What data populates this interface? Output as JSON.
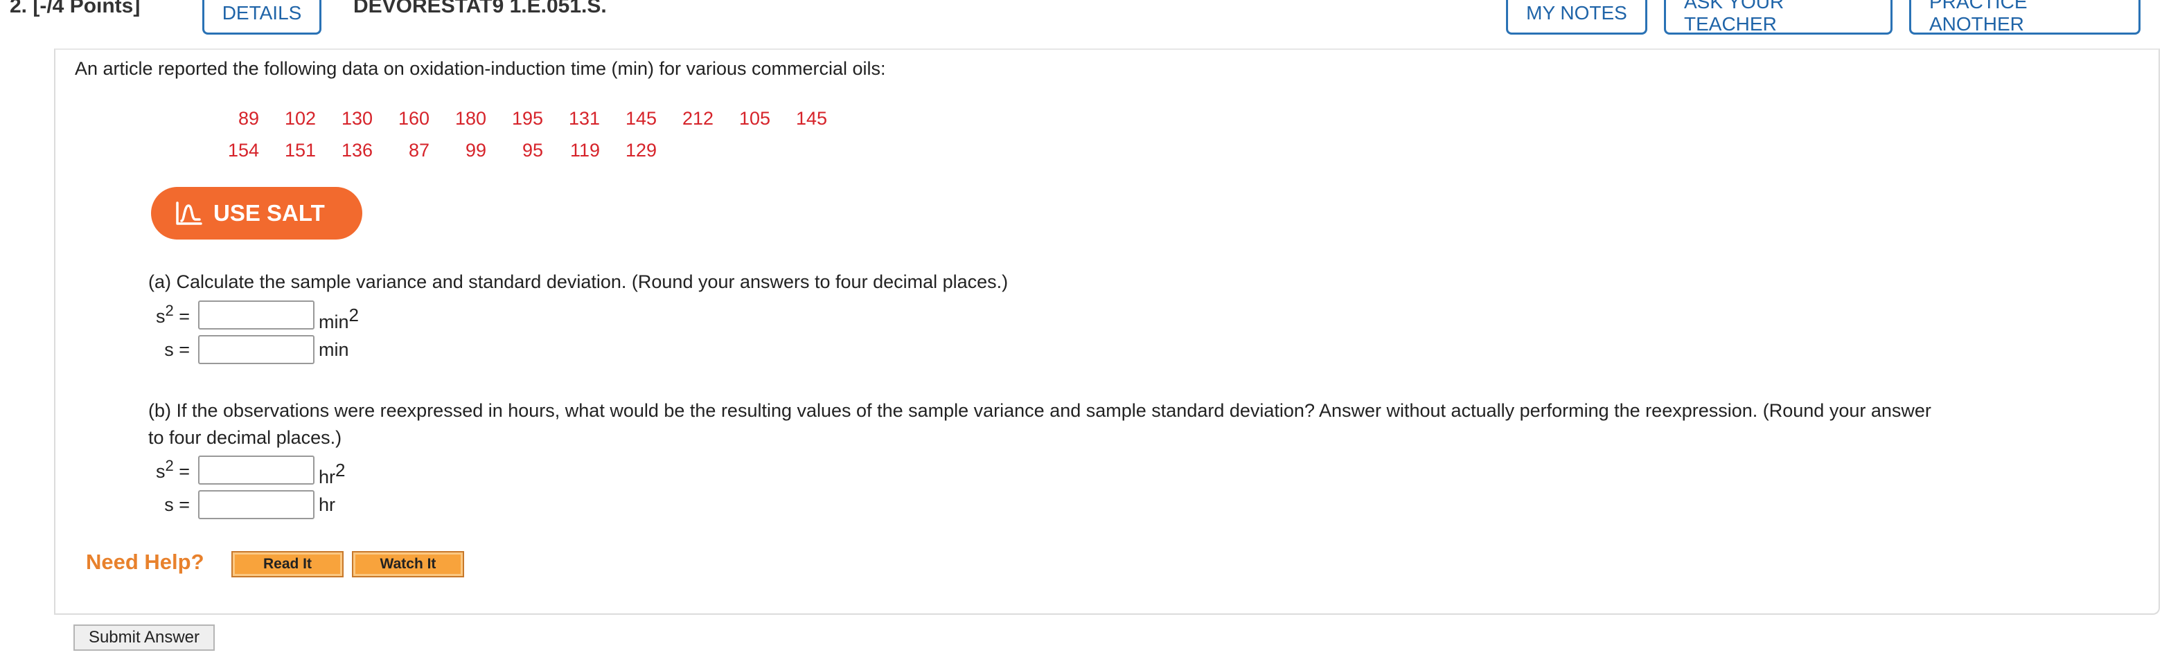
{
  "header": {
    "question_number": "2. [-/4 Points]",
    "details_label": "DETAILS",
    "question_code": "DEVORESTAT9 1.E.051.S.",
    "my_notes_label": "MY NOTES",
    "ask_teacher_label": "ASK YOUR TEACHER",
    "practice_another_label": "PRACTICE ANOTHER"
  },
  "prompt": "An article reported the following data on oxidation-induction time (min) for various commercial oils:",
  "data": {
    "row1": [
      "89",
      "102",
      "130",
      "160",
      "180",
      "195",
      "131",
      "145",
      "212",
      "105",
      "145"
    ],
    "row2": [
      "154",
      "151",
      "136",
      "87",
      "99",
      "95",
      "119",
      "129"
    ],
    "color": "#d6232a"
  },
  "salt_button": {
    "label": "USE SALT",
    "icon": "salt-chart-icon",
    "color": "#f26a2e"
  },
  "part_a": {
    "question": "(a) Calculate the sample variance and standard deviation. (Round your answers to four decimal places.)",
    "variance_label": "s",
    "variance_exp": "2",
    "variance_eq": " =",
    "variance_value": "",
    "variance_unit": "min",
    "variance_unit_exp": "2",
    "sd_label": "s =",
    "sd_value": "",
    "sd_unit": "min"
  },
  "part_b": {
    "question_line1": "(b) If the observations were reexpressed in hours, what would be the resulting values of the sample variance and sample standard deviation? Answer without actually performing the reexpression. (Round your answer",
    "question_line2": "to four decimal places.)",
    "variance_label": "s",
    "variance_exp": "2",
    "variance_eq": " =",
    "variance_value": "",
    "variance_unit": "hr",
    "variance_unit_exp": "2",
    "sd_label": "s =",
    "sd_value": "",
    "sd_unit": "hr"
  },
  "help": {
    "label": "Need Help?",
    "read_it": "Read It",
    "watch_it": "Watch It"
  },
  "submit_label": "Submit Answer"
}
